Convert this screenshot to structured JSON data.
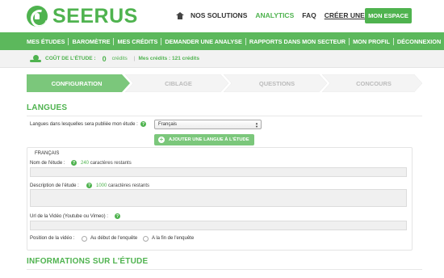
{
  "header": {
    "logo_text": "SEERUS",
    "nav": [
      {
        "label": "NOS SOLUTIONS",
        "style": "normal"
      },
      {
        "label": "ANALYTICS",
        "style": "active"
      },
      {
        "label": "FAQ",
        "style": "normal"
      },
      {
        "label": "CRÉER UNE ÉTUDE",
        "style": "underline"
      }
    ],
    "espace_label": "MON ESPACE"
  },
  "menu": {
    "items": [
      "MES ÉTUDES",
      "BAROMÈTRE",
      "MES CRÉDITS",
      "DEMANDER UNE ANALYSE",
      "RAPPORTS DANS MON SECTEUR",
      "MON PROFIL",
      "DÉCONNEXION"
    ]
  },
  "credits": {
    "cost_label": "COÛT DE L'ÉTUDE :",
    "cost_value": "0",
    "cost_unit": "crédits",
    "separator": "|",
    "available": "Mes crédits : 121 crédits"
  },
  "steps": [
    {
      "label": "CONFIGURATION",
      "active": true
    },
    {
      "label": "CIBLAGE",
      "active": false
    },
    {
      "label": "QUESTIONS",
      "active": false
    },
    {
      "label": "CONCOURS",
      "active": false
    }
  ],
  "langues": {
    "title": "LANGUES",
    "select_label": "Langues dans lesquelles sera publiée mon étude :",
    "select_value": "Français",
    "add_button": "AJOUTER UNE LANGUE À L'ÉTUDE",
    "help_glyph": "?",
    "box": {
      "title": "FRANÇAIS",
      "name_label": "Nom de l'étude :",
      "name_count": "240",
      "name_count_suffix": "caractères restants",
      "desc_label": "Description de l'étude :",
      "desc_count": "1000",
      "desc_count_suffix": "caractères restants",
      "video_label": "Url de la Vidéo (Youtube ou Vimeo) :",
      "position_label": "Position de la vidéo :",
      "position_options": [
        "Au début de l'enquête",
        "A la fin de l'enquête"
      ]
    }
  },
  "infos": {
    "title": "INFORMATIONS SUR L'ÉTUDE"
  },
  "colors": {
    "brand_green": "#4fb34f",
    "menu_green": "#5cb85c",
    "step_inactive": "#f4f4f4"
  }
}
